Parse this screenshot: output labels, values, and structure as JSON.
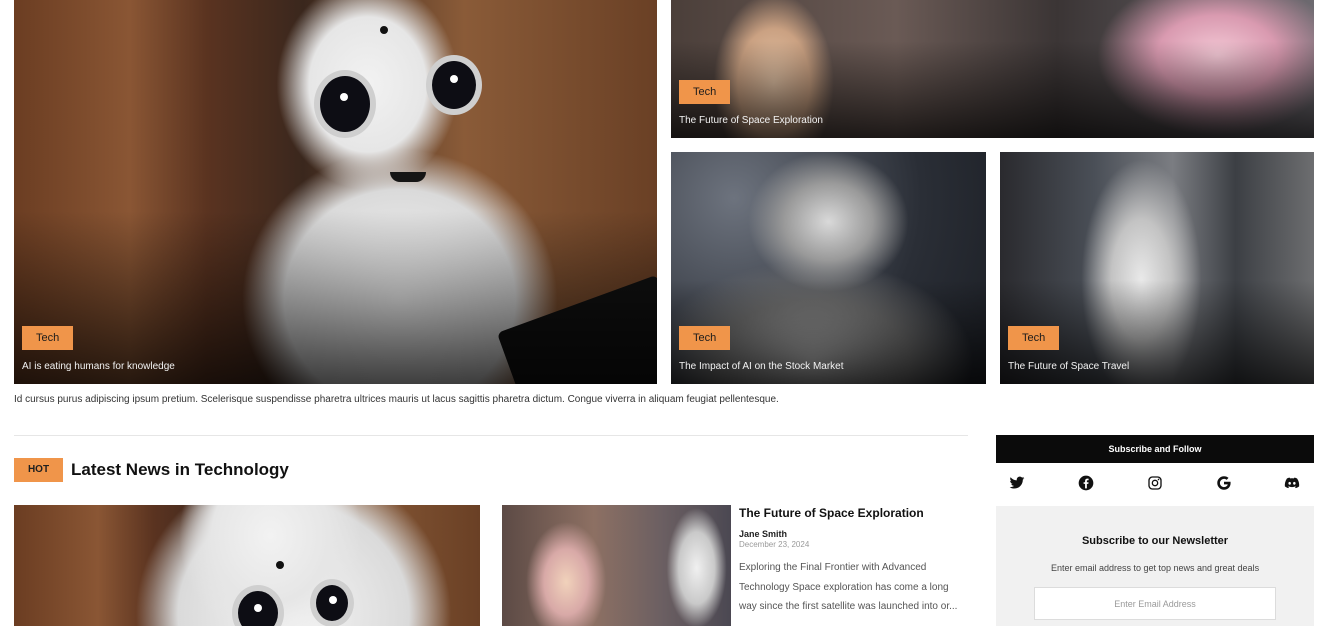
{
  "featured": [
    {
      "tag": "Tech",
      "caption": "AI is eating humans for knowledge"
    },
    {
      "tag": "Tech",
      "caption": "The Future of Space Exploration"
    },
    {
      "tag": "Tech",
      "caption": "The Impact of AI on the Stock Market"
    },
    {
      "tag": "Tech",
      "caption": "The Future of Space Travel"
    }
  ],
  "intro_text": "Id cursus purus adipiscing ipsum pretium. Scelerisque suspendisse pharetra ultrices mauris ut lacus sagittis pharetra dictum. Congue viverra in aliquam feugiat pellentesque.",
  "latest": {
    "badge": "HOT",
    "heading": "Latest News in Technology",
    "article": {
      "title": "The Future of Space Exploration",
      "author": "Jane Smith",
      "date": "December 23, 2024",
      "excerpt": "Exploring the Final Frontier with Advanced Technology Space exploration has come a long way since the first satellite was launched into or..."
    }
  },
  "sidebar": {
    "follow_title": "Subscribe and Follow",
    "social_icons": [
      "twitter-icon",
      "facebook-icon",
      "instagram-icon",
      "google-icon",
      "discord-icon"
    ],
    "newsletter": {
      "title": "Subscribe to our Newsletter",
      "subtitle": "Enter email address to get top news and great deals",
      "email_placeholder": "Enter Email Address"
    }
  },
  "colors": {
    "accent": "#f0954a",
    "dark_bar": "#0b0b0b",
    "panel": "#f1f1f1"
  }
}
